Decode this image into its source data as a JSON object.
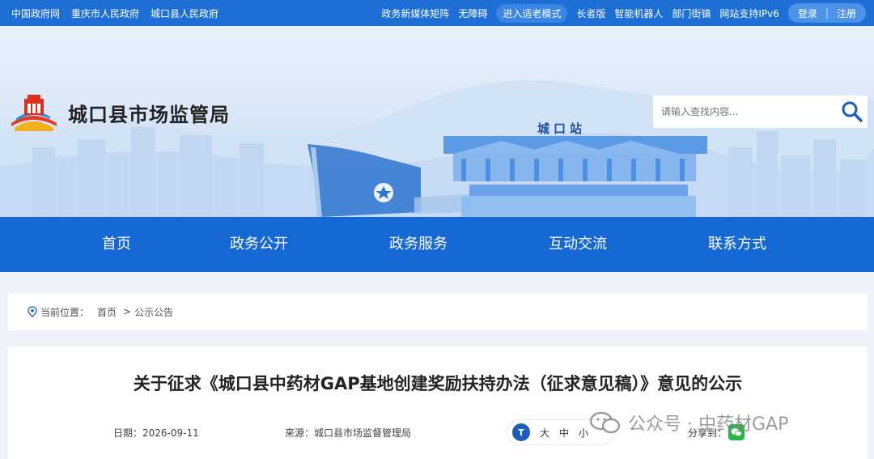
{
  "topbar": {
    "left_links": [
      "中国政府网",
      "重庆市人民政府",
      "城口县人民政府"
    ],
    "right_links": [
      "政务新媒体矩阵",
      "无障碍"
    ],
    "elder_mode": "进入适老模式",
    "right_links2": [
      "长者版",
      "智能机器人",
      "部门街镇",
      "网站支持IPv6"
    ],
    "login": "登录",
    "separator": "|",
    "register": "注册"
  },
  "header": {
    "site_title": "城口县市场监管局",
    "search_placeholder": "请输入查找内容...",
    "station_label": "城口站"
  },
  "nav": {
    "items": [
      "首页",
      "政务公开",
      "政务服务",
      "互动交流",
      "联系方式"
    ]
  },
  "breadcrumb": {
    "prefix": "当前位置：",
    "home": "首页",
    "separator": ">",
    "current": "公示公告"
  },
  "article": {
    "title": "关于征求《城口县中药材GAP基地创建奖励扶持办法（征求意见稿）》意见的公示",
    "date_label": "日期：",
    "date": "2026-09-11",
    "source_label": "来源：",
    "source": "城口县市场监督管理局",
    "font_size_labels": [
      "大",
      "中",
      "小"
    ],
    "font_icon_text": "T",
    "share_label": "分享到："
  },
  "watermark": {
    "text": "公众号 · 中药材GAP"
  },
  "colors": {
    "topbar": "#1d6fd6",
    "nav": "#1669d4",
    "page_bg": "#eef2f8"
  }
}
